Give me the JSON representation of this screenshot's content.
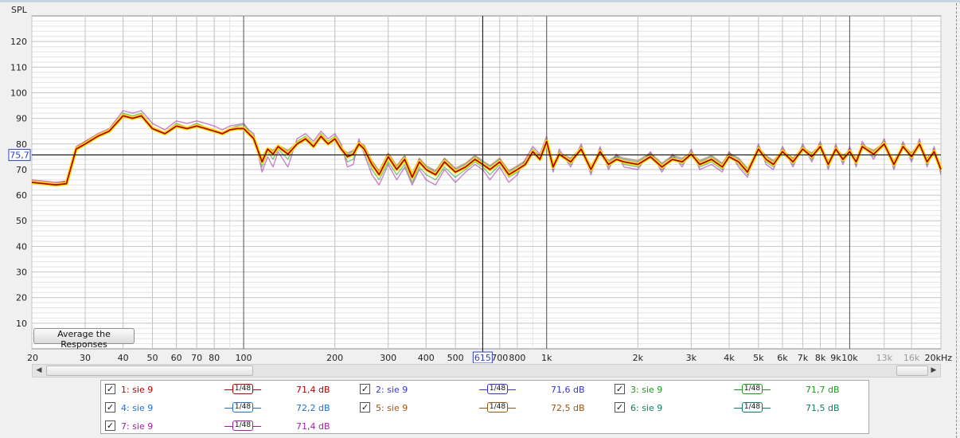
{
  "chart_data": {
    "type": "line",
    "ylabel": "SPL",
    "xscale": "log",
    "xlim": [
      20,
      20000
    ],
    "ylim": [
      0,
      130
    ],
    "y_ticks": [
      10,
      20,
      30,
      40,
      50,
      60,
      70,
      80,
      90,
      100,
      110,
      120
    ],
    "x_ticks": [
      {
        "value": 20,
        "label": "20"
      },
      {
        "value": 30,
        "label": "30"
      },
      {
        "value": 40,
        "label": "40"
      },
      {
        "value": 50,
        "label": "50"
      },
      {
        "value": 60,
        "label": "60"
      },
      {
        "value": 70,
        "label": "70"
      },
      {
        "value": 80,
        "label": "80"
      },
      {
        "value": 100,
        "label": "100"
      },
      {
        "value": 200,
        "label": "200"
      },
      {
        "value": 300,
        "label": "300"
      },
      {
        "value": 400,
        "label": "400"
      },
      {
        "value": 500,
        "label": "500"
      },
      {
        "value": 700,
        "label": "700"
      },
      {
        "value": 800,
        "label": "800"
      },
      {
        "value": 1000,
        "label": "1k"
      },
      {
        "value": 2000,
        "label": "2k"
      },
      {
        "value": 3000,
        "label": "3k"
      },
      {
        "value": 4000,
        "label": "4k"
      },
      {
        "value": 5000,
        "label": "5k"
      },
      {
        "value": 6000,
        "label": "6k"
      },
      {
        "value": 7000,
        "label": "7k"
      },
      {
        "value": 8000,
        "label": "8k"
      },
      {
        "value": 9000,
        "label": "9k"
      },
      {
        "value": 10000,
        "label": "10k"
      },
      {
        "value": 13000,
        "label": "13k",
        "dim": true
      },
      {
        "value": 16000,
        "label": "16k",
        "dim": true
      },
      {
        "value": 20000,
        "label": "20kHz"
      }
    ],
    "cursor": {
      "x": 615,
      "x_label": "615",
      "y": 75.7,
      "y_label": "75,7"
    },
    "grid": true,
    "average_curve": {
      "color": "#b80000",
      "outline_color": "#ffe600",
      "x": [
        20,
        22,
        24,
        26,
        28,
        30,
        33,
        36,
        40,
        43,
        46,
        50,
        55,
        60,
        65,
        70,
        75,
        80,
        85,
        90,
        95,
        100,
        104,
        108,
        115,
        120,
        125,
        130,
        140,
        150,
        160,
        170,
        180,
        190,
        200,
        210,
        220,
        230,
        240,
        250,
        265,
        280,
        300,
        320,
        340,
        360,
        380,
        400,
        430,
        460,
        500,
        540,
        580,
        615,
        650,
        700,
        750,
        800,
        850,
        900,
        950,
        1000,
        1050,
        1100,
        1200,
        1300,
        1400,
        1500,
        1600,
        1700,
        1800,
        2000,
        2200,
        2400,
        2600,
        2800,
        3000,
        3200,
        3500,
        3800,
        4000,
        4300,
        4600,
        5000,
        5300,
        5600,
        6000,
        6500,
        7000,
        7500,
        8000,
        8500,
        9000,
        9500,
        10000,
        10500,
        11000,
        12000,
        13000,
        14000,
        15000,
        16000,
        17000,
        18000,
        19000,
        20000
      ],
      "y": [
        65,
        64.5,
        64,
        64.5,
        78,
        80,
        83,
        85,
        91,
        90,
        91,
        86,
        84,
        87,
        86,
        87,
        86,
        85,
        84,
        85.5,
        86,
        86,
        84,
        82,
        73,
        78,
        76,
        79,
        76,
        80,
        82,
        79,
        83,
        80,
        82,
        78,
        75,
        76,
        80,
        78,
        72,
        68,
        75,
        70,
        74,
        67,
        73,
        70,
        68,
        73,
        69,
        71,
        74,
        72,
        70,
        73,
        68,
        70,
        72,
        77,
        74,
        81,
        71,
        76,
        73,
        78,
        70,
        77,
        72,
        74,
        73,
        72,
        75,
        71,
        74,
        73,
        76,
        72,
        74,
        71,
        75,
        73,
        69,
        78,
        74,
        72,
        77,
        73,
        78,
        75,
        79,
        72,
        78,
        74,
        77,
        73,
        79,
        76,
        80,
        72,
        79,
        75,
        80,
        73,
        77,
        70
      ]
    },
    "series": [
      {
        "name": "1: sie 9",
        "color": "#b80000",
        "smoothing": "1/48",
        "level": "71,4 dB",
        "y": [
          65,
          64.5,
          64,
          64.5,
          78,
          80,
          83,
          85,
          91,
          90,
          91,
          86,
          84,
          87,
          86,
          87,
          86,
          85,
          84,
          85.5,
          86,
          86,
          84,
          82,
          73,
          78,
          76,
          79,
          76,
          80,
          82,
          79,
          83,
          80,
          82,
          78,
          75,
          76,
          80,
          78,
          72,
          68,
          75,
          70,
          74,
          67,
          73,
          70,
          68,
          73,
          69,
          71,
          74,
          72,
          70,
          73,
          68,
          70,
          72,
          77,
          74,
          81,
          71,
          76,
          73,
          78,
          70,
          77,
          72,
          74,
          73,
          72,
          75,
          71,
          74,
          73,
          76,
          72,
          74,
          71,
          75,
          73,
          69,
          78,
          74,
          72,
          77,
          73,
          78,
          75,
          79,
          72,
          78,
          74,
          77,
          73,
          79,
          76,
          80,
          72,
          79,
          75,
          80,
          73,
          77,
          70
        ]
      },
      {
        "name": "2: sie 9",
        "color": "#3535d6",
        "smoothing": "1/48",
        "level": "71,6 dB",
        "y": [
          65.5,
          65,
          64.5,
          65,
          78.5,
          80.5,
          83.5,
          85.5,
          91.5,
          90.5,
          91.5,
          86.5,
          84.5,
          87.5,
          86.5,
          87.5,
          86.5,
          85.5,
          84.5,
          86,
          86.5,
          86.5,
          84.5,
          82.5,
          73.5,
          78.5,
          76.5,
          79.5,
          76.5,
          80.5,
          82.5,
          79.5,
          83.5,
          80.5,
          82.5,
          78.5,
          75.5,
          76.5,
          80.5,
          78.5,
          72.5,
          68.5,
          75.5,
          70.5,
          74.5,
          67.5,
          73.5,
          70.5,
          68.5,
          73.5,
          69.5,
          71.5,
          74.5,
          72.5,
          70.5,
          73.5,
          68.5,
          70.5,
          72.5,
          77.5,
          74.5,
          81.5,
          71.5,
          76.5,
          73.5,
          78.5,
          70.5,
          77.5,
          72.5,
          74.5,
          73.5,
          72.5,
          75.5,
          71.5,
          74.5,
          73.5,
          76.5,
          72.5,
          74.5,
          71.5,
          75.5,
          73.5,
          69.5,
          78.5,
          74.5,
          72.5,
          77.5,
          73.5,
          78.5,
          75.5,
          79.5,
          72.5,
          78.5,
          74.5,
          77.5,
          73.5,
          79.5,
          76.5,
          80.5,
          72.5,
          79.5,
          75.5,
          80.5,
          73.5,
          77.5,
          70.5
        ]
      },
      {
        "name": "3: sie 9",
        "color": "#1a9a1a",
        "smoothing": "1/48",
        "level": "71,7 dB",
        "y": [
          64.5,
          64,
          63.5,
          64,
          77.5,
          80,
          83.5,
          85.5,
          92,
          91,
          92,
          86.5,
          84.5,
          88,
          86.5,
          88,
          86.5,
          85.5,
          84,
          86,
          87,
          87.5,
          85,
          83,
          71,
          77,
          74,
          78,
          74,
          81,
          83,
          80,
          84,
          81,
          83,
          79,
          73,
          74,
          81,
          77,
          70,
          66,
          73,
          68,
          72,
          65,
          71,
          68,
          66,
          71,
          67,
          70,
          73,
          71,
          68,
          72,
          67,
          69,
          73,
          78,
          75,
          82,
          70,
          77,
          72,
          79,
          69,
          78,
          71,
          75,
          72,
          71,
          76,
          70,
          75,
          72,
          77,
          71,
          73,
          70,
          76,
          72,
          68,
          79,
          73,
          71,
          78,
          72,
          79,
          74,
          80,
          71,
          79,
          73,
          78,
          72,
          80,
          75,
          81,
          71,
          80,
          74,
          81,
          72,
          78,
          69
        ]
      },
      {
        "name": "4: sie 9",
        "color": "#1f6fc9",
        "smoothing": "1/48",
        "level": "72,2 dB",
        "y": [
          65,
          64.5,
          64,
          65,
          78,
          80.5,
          83,
          85,
          91.5,
          90.5,
          91.5,
          86,
          84,
          87.5,
          86,
          87.5,
          86,
          85,
          84,
          85.5,
          86.5,
          86.5,
          84,
          82,
          74,
          78,
          77,
          79,
          77,
          80,
          82,
          79,
          83,
          80,
          82,
          78,
          76,
          77,
          80,
          79,
          73,
          69,
          76,
          71,
          75,
          68,
          74,
          71,
          69,
          74,
          70,
          72,
          75,
          73,
          71,
          74,
          69,
          71,
          73,
          77,
          75,
          81,
          72,
          76,
          74,
          78,
          71,
          77,
          73,
          75,
          74,
          73,
          76,
          72,
          75,
          74,
          76,
          73,
          75,
          72,
          76,
          74,
          70,
          78,
          75,
          73,
          77,
          74,
          78,
          76,
          79,
          73,
          78,
          75,
          77,
          74,
          79,
          77,
          80,
          73,
          79,
          76,
          80,
          74,
          77,
          71
        ]
      },
      {
        "name": "5: sie 9",
        "color": "#9a5412",
        "smoothing": "1/48",
        "level": "72,5 dB",
        "y": [
          65.5,
          65,
          64.5,
          65.5,
          78.5,
          81,
          83.5,
          85.5,
          91,
          90,
          91,
          86.5,
          84.5,
          87,
          86.5,
          87,
          86.5,
          85.5,
          84.5,
          86,
          86,
          86,
          84.5,
          82.5,
          74.5,
          78.5,
          77.5,
          79.5,
          77.5,
          80.5,
          82.5,
          79.5,
          83.5,
          80.5,
          82.5,
          78.5,
          76.5,
          77.5,
          80.5,
          79.5,
          73.5,
          69.5,
          76.5,
          71.5,
          75.5,
          68.5,
          74.5,
          71.5,
          69.5,
          74.5,
          70.5,
          72.5,
          75.5,
          73.5,
          71.5,
          74.5,
          69.5,
          71.5,
          73.5,
          77.5,
          75.5,
          81.5,
          72.5,
          76.5,
          74.5,
          78.5,
          71.5,
          77.5,
          73.5,
          75.5,
          74.5,
          73.5,
          76.5,
          72.5,
          75.5,
          74.5,
          76.5,
          73.5,
          75.5,
          72.5,
          76.5,
          74.5,
          70.5,
          78.5,
          75.5,
          73.5,
          77.5,
          74.5,
          78.5,
          76.5,
          79.5,
          73.5,
          78.5,
          75.5,
          77.5,
          74.5,
          79.5,
          77.5,
          80.5,
          73.5,
          79.5,
          76.5,
          80.5,
          74.5,
          77.5,
          71.5
        ]
      },
      {
        "name": "6: sie 9",
        "color": "#0e7a64",
        "smoothing": "1/48",
        "level": "71,5 dB",
        "y": [
          65,
          64.5,
          64,
          64.5,
          78,
          80,
          83,
          85,
          91,
          90,
          91,
          86,
          84,
          87,
          86,
          87,
          86,
          85,
          84,
          85.5,
          86,
          86,
          84,
          82,
          73,
          78,
          76,
          79,
          76,
          80,
          82,
          79,
          83,
          80,
          82,
          78,
          75,
          76,
          80,
          78,
          72,
          68,
          75,
          70,
          74,
          67,
          73,
          70,
          68,
          73,
          69,
          71,
          74,
          72,
          70,
          73,
          68,
          70,
          72,
          77,
          74,
          81,
          71,
          76,
          73,
          78,
          70,
          77,
          72,
          74,
          73,
          72,
          75,
          71,
          74,
          73,
          76,
          72,
          74,
          71,
          75,
          73,
          69,
          78,
          74,
          72,
          77,
          73,
          78,
          75,
          79,
          72,
          78,
          74,
          77,
          73,
          79,
          76,
          80,
          72,
          79,
          75,
          80,
          73,
          77,
          70
        ]
      },
      {
        "name": "7: sie 9",
        "color": "#a21ea2",
        "smoothing": "1/48",
        "level": "71,4 dB",
        "y": [
          66,
          65.5,
          65,
          65.5,
          79,
          81,
          84,
          86,
          93,
          92,
          93,
          88,
          85.5,
          89,
          88,
          89,
          88,
          87,
          85.5,
          87,
          87.5,
          88,
          85.5,
          84,
          69,
          75,
          71,
          77,
          71,
          82,
          84,
          81,
          85,
          82,
          84,
          80,
          71,
          72,
          82,
          76,
          68,
          64,
          72,
          66,
          71,
          64,
          70,
          66,
          64,
          70,
          65,
          69,
          72,
          70,
          66,
          71,
          65,
          68,
          74,
          79,
          76,
          83,
          69,
          78,
          71,
          80,
          68,
          79,
          70,
          76,
          71,
          70,
          77,
          69,
          76,
          71,
          78,
          70,
          72,
          69,
          77,
          71,
          67,
          80,
          72,
          70,
          79,
          71,
          80,
          73,
          81,
          70,
          80,
          72,
          79,
          71,
          81,
          74,
          82,
          70,
          81,
          73,
          82,
          71,
          79,
          68
        ]
      }
    ]
  },
  "ui": {
    "average_button": "Average the Responses"
  }
}
